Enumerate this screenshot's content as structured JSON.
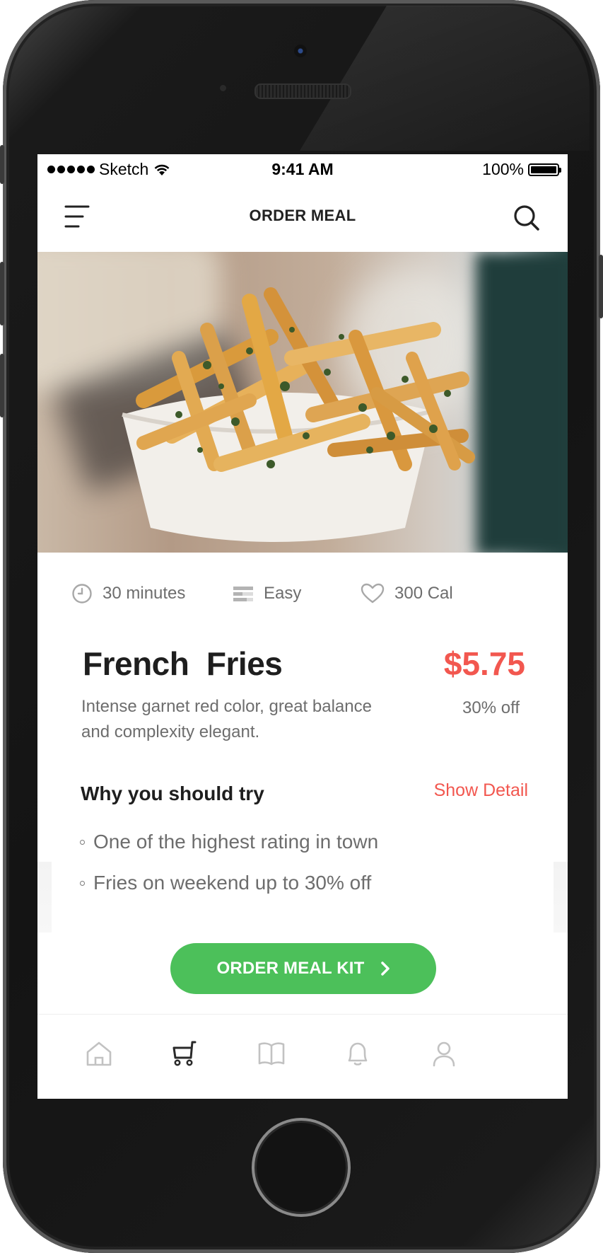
{
  "status_bar": {
    "carrier": "Sketch",
    "time": "9:41 AM",
    "battery": "100%"
  },
  "nav": {
    "title": "ORDER MEAL"
  },
  "meal": {
    "time": "30 minutes",
    "difficulty": "Easy",
    "calories": "300 Cal",
    "name": "French  Fries",
    "price": "$5.75",
    "discount": "30% off",
    "description": "Intense garnet red color, great balance and complexity elegant."
  },
  "why": {
    "heading": "Why you should try",
    "show_detail": "Show Detail",
    "reasons": [
      "One of the highest rating in town",
      "Fries on weekend up to 30% off"
    ]
  },
  "cta": {
    "label": "ORDER MEAL KIT"
  },
  "tab_bar": {
    "items": [
      "home-icon",
      "cart-icon",
      "book-icon",
      "bell-icon",
      "profile-icon"
    ],
    "active_index": 1
  },
  "colors": {
    "accent_red": "#f2574f",
    "button_green": "#4cc05a",
    "text_dark": "#1e1e1e",
    "text_gray": "#6d6d6d"
  }
}
